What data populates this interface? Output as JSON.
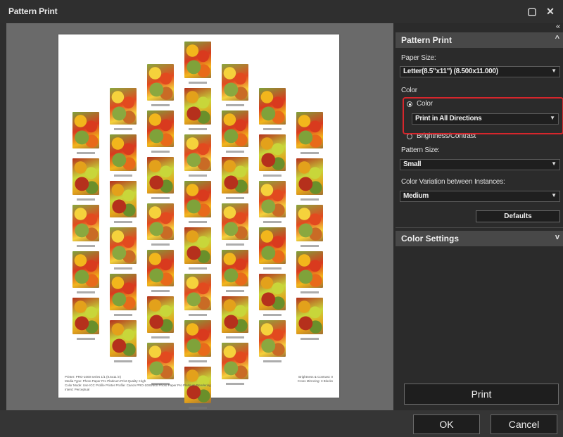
{
  "window": {
    "title": "Pattern Print",
    "restore_glyph": "▢",
    "close_glyph": "✕"
  },
  "panel": {
    "collapse_glyph": "«",
    "section1": {
      "title": "Pattern Print",
      "chevron": "^"
    },
    "paper_size": {
      "label": "Paper Size:",
      "value": "Letter(8.5\"x11\") (8.500x11.000)"
    },
    "color": {
      "label": "Color",
      "option_color": "Color",
      "direction_value": "Print in All Directions",
      "option_brightness": "Brightness/Contrast"
    },
    "pattern_size": {
      "label": "Pattern Size:",
      "value": "Small"
    },
    "variation": {
      "label": "Color Variation between Instances:",
      "value": "Medium"
    },
    "defaults_button": "Defaults",
    "section2": {
      "title": "Color Settings",
      "chevron": "v"
    },
    "print_button": "Print"
  },
  "footer": {
    "ok_button": "OK",
    "cancel_button": "Cancel"
  },
  "paper_footer": {
    "left": [
      "Printer: PRO-1000 series  1/1 (8.5x11 in)",
      "Media Type: Photo Paper Pro Platinum   Print Quality: High",
      "Color Mode: Use ICC Profile   Printer Profile: Canon PRO-1000/500 Photo Paper Pro Platinum   Rendering Intent: Perceptual"
    ],
    "right": [
      "Brightness & Contrast: 0",
      "Cross Mirroring: 3 Blocks"
    ]
  },
  "colors": {
    "accent_highlight": "#d6262c",
    "panel_bg": "#2b2b2b",
    "preview_bg": "#6a6a6a"
  }
}
